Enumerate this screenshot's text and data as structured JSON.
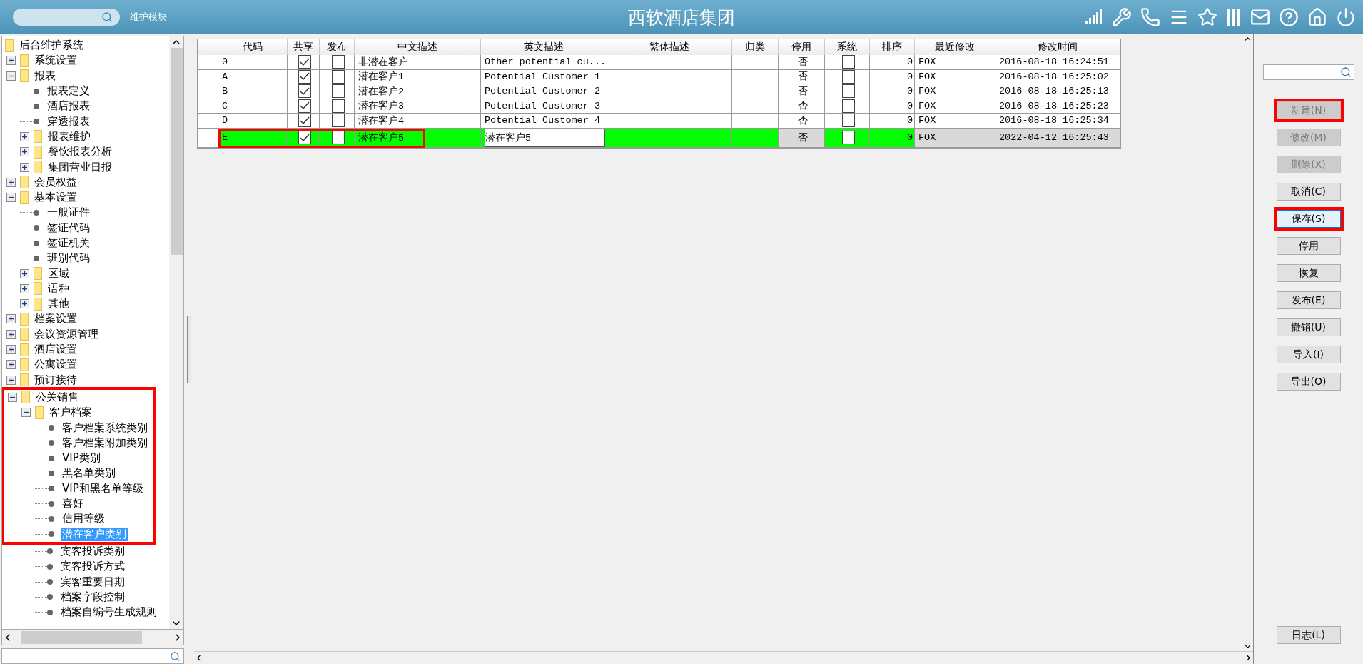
{
  "header": {
    "module_label": "维护模块",
    "title": "西软酒店集团"
  },
  "tree": {
    "root": "后台维护系统",
    "items": [
      {
        "kind": "folder",
        "label": "系统设置",
        "expanded": false,
        "highlighted": false
      },
      {
        "kind": "folder",
        "label": "报表",
        "expanded": true,
        "highlighted": false,
        "children": [
          {
            "kind": "leaf",
            "label": "报表定义",
            "selected": false,
            "highlighted": false
          },
          {
            "kind": "leaf",
            "label": "酒店报表",
            "selected": false,
            "highlighted": false
          },
          {
            "kind": "leaf",
            "label": "穿透报表",
            "selected": false,
            "highlighted": false
          },
          {
            "kind": "folder",
            "label": "报表维护",
            "expanded": false,
            "highlighted": false
          },
          {
            "kind": "folder",
            "label": "餐饮报表分析",
            "expanded": false,
            "highlighted": false
          },
          {
            "kind": "folder",
            "label": "集团营业日报",
            "expanded": false,
            "highlighted": false
          }
        ]
      },
      {
        "kind": "folder",
        "label": "会员权益",
        "expanded": false,
        "highlighted": false
      },
      {
        "kind": "folder",
        "label": "基本设置",
        "expanded": true,
        "highlighted": false,
        "children": [
          {
            "kind": "leaf",
            "label": "一般证件",
            "selected": false,
            "highlighted": false
          },
          {
            "kind": "leaf",
            "label": "签证代码",
            "selected": false,
            "highlighted": false
          },
          {
            "kind": "leaf",
            "label": "签证机关",
            "selected": false,
            "highlighted": false
          },
          {
            "kind": "leaf",
            "label": "班别代码",
            "selected": false,
            "highlighted": false
          },
          {
            "kind": "folder",
            "label": "区域",
            "expanded": false,
            "highlighted": false
          },
          {
            "kind": "folder",
            "label": "语种",
            "expanded": false,
            "highlighted": false
          },
          {
            "kind": "folder",
            "label": "其他",
            "expanded": false,
            "highlighted": false
          }
        ]
      },
      {
        "kind": "folder",
        "label": "档案设置",
        "expanded": false,
        "highlighted": false
      },
      {
        "kind": "folder",
        "label": "会议资源管理",
        "expanded": false,
        "highlighted": false
      },
      {
        "kind": "folder",
        "label": "酒店设置",
        "expanded": false,
        "highlighted": false
      },
      {
        "kind": "folder",
        "label": "公寓设置",
        "expanded": false,
        "highlighted": false
      },
      {
        "kind": "folder",
        "label": "预订接待",
        "expanded": false,
        "highlighted": false
      },
      {
        "kind": "folder",
        "label": "公关销售",
        "expanded": true,
        "highlighted": true,
        "children": [
          {
            "kind": "folder",
            "label": "客户档案",
            "expanded": true,
            "highlighted": true,
            "children": [
              {
                "kind": "leaf",
                "label": "客户档案系统类别",
                "selected": false,
                "highlighted": true
              },
              {
                "kind": "leaf",
                "label": "客户档案附加类别",
                "selected": false,
                "highlighted": true
              },
              {
                "kind": "leaf",
                "label": "VIP类别",
                "selected": false,
                "highlighted": true
              },
              {
                "kind": "leaf",
                "label": "黑名单类别",
                "selected": false,
                "highlighted": true
              },
              {
                "kind": "leaf",
                "label": "VIP和黑名单等级",
                "selected": false,
                "highlighted": true
              },
              {
                "kind": "leaf",
                "label": "喜好",
                "selected": false,
                "highlighted": true
              },
              {
                "kind": "leaf",
                "label": "信用等级",
                "selected": false,
                "highlighted": true
              },
              {
                "kind": "leaf",
                "label": "潜在客户类别",
                "selected": true,
                "highlighted": true
              },
              {
                "kind": "leaf",
                "label": "宾客投诉类别",
                "selected": false,
                "highlighted": false
              },
              {
                "kind": "leaf",
                "label": "宾客投诉方式",
                "selected": false,
                "highlighted": false
              },
              {
                "kind": "leaf",
                "label": "宾客重要日期",
                "selected": false,
                "highlighted": false
              },
              {
                "kind": "leaf",
                "label": "档案字段控制",
                "selected": false,
                "highlighted": false
              },
              {
                "kind": "leaf",
                "label": "档案自编号生成规则",
                "selected": false,
                "highlighted": false
              }
            ]
          }
        ]
      }
    ]
  },
  "table": {
    "columns": [
      {
        "label": "代码",
        "kind": "text",
        "readonly": false,
        "editable": false
      },
      {
        "label": "共享",
        "kind": "check",
        "readonly": false,
        "editable": false
      },
      {
        "label": "发布",
        "kind": "check",
        "readonly": false,
        "editable": false
      },
      {
        "label": "中文描述",
        "kind": "text",
        "readonly": false,
        "editable": false
      },
      {
        "label": "英文描述",
        "kind": "text",
        "readonly": false,
        "editable": true
      },
      {
        "label": "繁体描述",
        "kind": "text",
        "readonly": false,
        "editable": false
      },
      {
        "label": "归类",
        "kind": "text",
        "readonly": false,
        "editable": false
      },
      {
        "label": "停用",
        "kind": "center",
        "readonly": true,
        "editable": false
      },
      {
        "label": "系统",
        "kind": "check",
        "readonly": false,
        "editable": false
      },
      {
        "label": "排序",
        "kind": "right",
        "readonly": false,
        "editable": false
      },
      {
        "label": "最近修改",
        "kind": "text",
        "readonly": true,
        "editable": false
      },
      {
        "label": "修改时间",
        "kind": "text",
        "readonly": true,
        "editable": false
      }
    ],
    "rows": [
      {
        "selected": false,
        "editing": false,
        "highlighted": false,
        "cells": [
          "0",
          true,
          false,
          "非潜在客户",
          "Other potential cu...",
          null,
          null,
          "否",
          false,
          "0",
          "FOX",
          "2016-08-18 16:24:51"
        ]
      },
      {
        "selected": false,
        "editing": false,
        "highlighted": false,
        "cells": [
          "A",
          true,
          false,
          "潜在客户1",
          "Potential Customer 1",
          null,
          null,
          "否",
          false,
          "0",
          "FOX",
          "2016-08-18 16:25:02"
        ]
      },
      {
        "selected": false,
        "editing": false,
        "highlighted": false,
        "cells": [
          "B",
          true,
          false,
          "潜在客户2",
          "Potential Customer 2",
          null,
          null,
          "否",
          false,
          "0",
          "FOX",
          "2016-08-18 16:25:13"
        ]
      },
      {
        "selected": false,
        "editing": false,
        "highlighted": false,
        "cells": [
          "C",
          true,
          false,
          "潜在客户3",
          "Potential Customer 3",
          null,
          null,
          "否",
          false,
          "0",
          "FOX",
          "2016-08-18 16:25:23"
        ]
      },
      {
        "selected": false,
        "editing": false,
        "highlighted": false,
        "cells": [
          "D",
          true,
          false,
          "潜在客户4",
          "Potential Customer 4",
          null,
          null,
          "否",
          false,
          "0",
          "FOX",
          "2016-08-18 16:25:34"
        ]
      },
      {
        "selected": true,
        "editing": true,
        "highlighted": true,
        "cells": [
          "E",
          true,
          false,
          "潜在客户5",
          "潜在客户5",
          null,
          null,
          "否",
          false,
          "0",
          "FOX",
          "2022-04-12 16:25:43"
        ]
      }
    ]
  },
  "buttons": [
    {
      "label": "新建(N)",
      "disabled": true,
      "focused": false,
      "highlighted": true
    },
    {
      "label": "修改(M)",
      "disabled": true,
      "focused": false,
      "highlighted": false
    },
    {
      "label": "删除(X)",
      "disabled": true,
      "focused": false,
      "highlighted": false
    },
    {
      "label": "取消(C)",
      "disabled": false,
      "focused": false,
      "highlighted": false
    },
    {
      "label": "保存(S)",
      "disabled": false,
      "focused": true,
      "highlighted": true
    },
    {
      "label": "停用",
      "disabled": false,
      "focused": false,
      "highlighted": false
    },
    {
      "label": "恢复",
      "disabled": false,
      "focused": false,
      "highlighted": false
    },
    {
      "label": "发布(E)",
      "disabled": false,
      "focused": false,
      "highlighted": false
    },
    {
      "label": "撤销(U)",
      "disabled": false,
      "focused": false,
      "highlighted": false
    },
    {
      "label": "导入(I)",
      "disabled": false,
      "focused": false,
      "highlighted": false
    },
    {
      "label": "导出(O)",
      "disabled": false,
      "focused": false,
      "highlighted": false
    }
  ],
  "log_button": {
    "label": "日志(L)"
  }
}
